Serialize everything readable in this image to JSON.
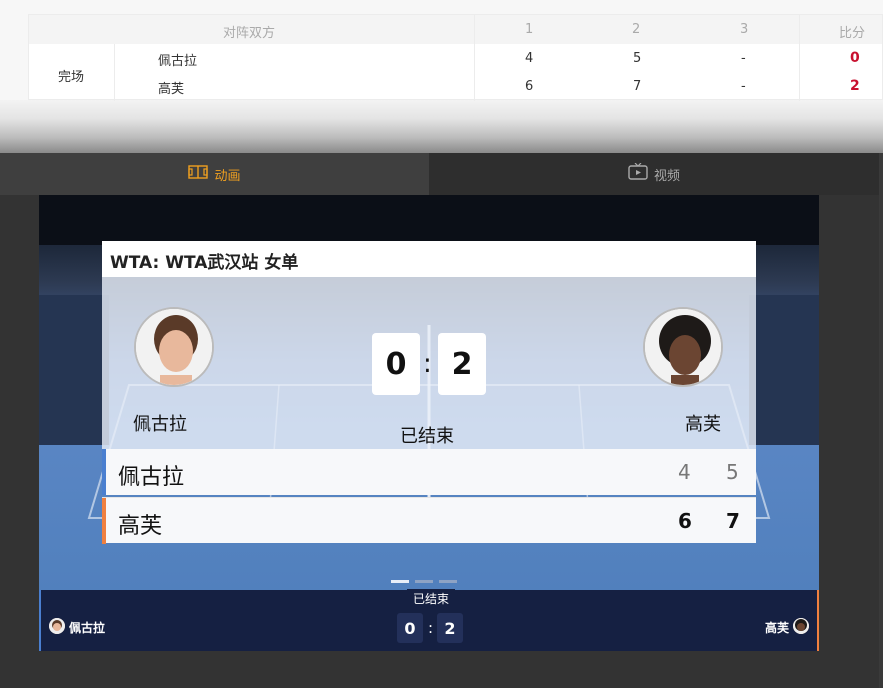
{
  "table": {
    "header_label": "对阵双方",
    "set_headers": [
      "1",
      "2",
      "3"
    ],
    "total_header": "比分",
    "status": "完场",
    "players": [
      {
        "name": "佩古拉",
        "sets": [
          "4",
          "5",
          "-"
        ],
        "total": "0"
      },
      {
        "name": "高芙",
        "sets": [
          "6",
          "7",
          "-"
        ],
        "total": "2"
      }
    ]
  },
  "tabs": {
    "animation": {
      "label": "动画",
      "icon": "court-icon"
    },
    "video": {
      "label": "视频",
      "icon": "tv-icon"
    }
  },
  "card": {
    "title": "WTA: WTA武汉站 女单",
    "home": {
      "name": "佩古拉",
      "score": "0",
      "color": "#4a7fd0",
      "set1": "4",
      "set2": "5"
    },
    "away": {
      "name": "高芙",
      "score": "2",
      "color": "#f08040",
      "set1": "6",
      "set2": "7"
    },
    "colon": ":",
    "status": "已结束"
  },
  "bottom_bar": {
    "status": "已结束",
    "home_name": "佩古拉",
    "away_name": "高芙",
    "home_score": "0",
    "away_score": "2",
    "colon": ":"
  }
}
